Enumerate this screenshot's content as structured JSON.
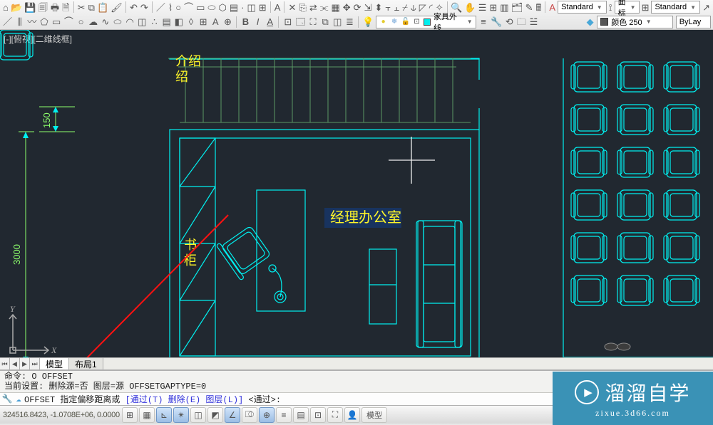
{
  "toolbar": {
    "row1_icons": [
      "⌂",
      "📂",
      "🖴",
      "🖶",
      "↶",
      "↷",
      "📋",
      "📄",
      "✏",
      "⎌",
      "⋯",
      "✎",
      "／",
      "⊞",
      "◯",
      "⌢",
      "〰",
      "⬠",
      "⬡",
      "◇",
      "▭",
      "A",
      "◉",
      "⎔",
      "✂",
      "⎘",
      "⟲",
      "⬍",
      "⇲",
      "□",
      "✦"
    ],
    "standard_label": "Standard",
    "layer_dim_label": "平面标注",
    "right_standard_label": "Standard"
  },
  "toolbar2": {
    "row2_icons": [
      "／",
      "〰",
      "⌒",
      "○",
      "▭",
      "⬠",
      "⊗",
      "∴",
      "A",
      "⎔",
      "⎘",
      "↔",
      "⟳",
      "⌫",
      "⎌",
      "◫",
      "□",
      "⊞",
      "T",
      "B",
      "A",
      "I"
    ],
    "palette_icons": [
      "⊡",
      "🗔",
      "⛶",
      "⊞",
      "⧉",
      "◫"
    ],
    "layer_combo_icons": [
      "💡",
      "❄",
      "🔓",
      "🖶"
    ],
    "layer_name": "家具外线",
    "tool_icons_mid": [
      "≡",
      "🔧",
      "⚙",
      "🗀",
      "☱"
    ],
    "color_label": "颜色 250",
    "linetype_label": "ByLay"
  },
  "viewport_label": "[-][俯视][二维线框]",
  "drawing": {
    "intro_label": "介绍",
    "room_label": "经理办公室",
    "bookshelf_label": "书柜",
    "dim_150": "150",
    "dim_3000": "3000",
    "ucs_x": "X",
    "ucs_y": "Y"
  },
  "tabs": {
    "model": "模型",
    "layout1": "布局1"
  },
  "cmd": {
    "line1": "命令: O  OFFSET",
    "line2_a": "当前设置: 删除源=否  图层=源  OFFSETGAPTYPE=0",
    "prompt_prefix": "OFFSET 指定偏移距离或 ",
    "prompt_opts": "[通过(T) 删除(E) 图层(L)]",
    "prompt_suffix": " <通过>:"
  },
  "status": {
    "coords": "324516.8423, -1.0708E+06, 0.0000",
    "right_model": "模型"
  },
  "watermark": {
    "title": "溜溜自学",
    "sub": "zixue.3d66.com"
  }
}
